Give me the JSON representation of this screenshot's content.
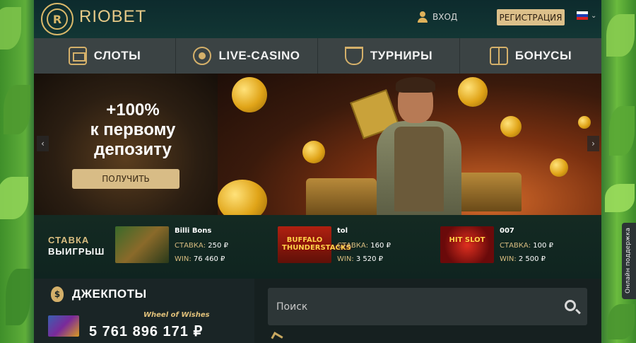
{
  "brand": {
    "name": "RIOBET"
  },
  "header": {
    "login_label": "ВХОД",
    "register_label": "РЕГИСТРАЦИЯ"
  },
  "nav": {
    "items": [
      {
        "label": "СЛОТЫ",
        "icon": "slot-machine-icon"
      },
      {
        "label": "LIVE-CASINO",
        "icon": "roulette-icon"
      },
      {
        "label": "ТУРНИРЫ",
        "icon": "trophy-icon"
      },
      {
        "label": "БОНУСЫ",
        "icon": "gift-icon"
      }
    ]
  },
  "banner": {
    "promo_line1": "+100%",
    "promo_line2": "к первому",
    "promo_line3": "депозиту",
    "cta_label": "ПОЛУЧИТЬ",
    "prev_arrow": "‹",
    "next_arrow": "›"
  },
  "winners": {
    "heading_stake": "СТАВКА",
    "heading_win": "ВЫИГРЫШ",
    "items": [
      {
        "player": "Billi Bons",
        "bet_label": "СТАВКА:",
        "bet": "250 ₽",
        "win_label": "WIN:",
        "win": "76 460 ₽",
        "thumb_title": ""
      },
      {
        "player": "tol",
        "bet_label": "СТАВКА:",
        "bet": "160 ₽",
        "win_label": "WIN:",
        "win": "3 520 ₽",
        "thumb_title": "BUFFALO THUNDERSTACKS"
      },
      {
        "player": "007",
        "bet_label": "СТАВКА:",
        "bet": "100 ₽",
        "win_label": "WIN:",
        "win": "2 500 ₽",
        "thumb_title": "HIT SLOT"
      }
    ]
  },
  "jackpot": {
    "title": "ДЖЕКПОТЫ",
    "icon": "money-bag-icon",
    "game": "Wheel of Wishes",
    "amount": "5 761 896 171 ₽"
  },
  "search": {
    "placeholder": "Поиск"
  },
  "support": {
    "label": "Онлайн поддержка"
  },
  "colors": {
    "accent_gold": "#d9bd80",
    "nav_bg": "#3b4344",
    "header_bg": "#0d2b2d"
  }
}
